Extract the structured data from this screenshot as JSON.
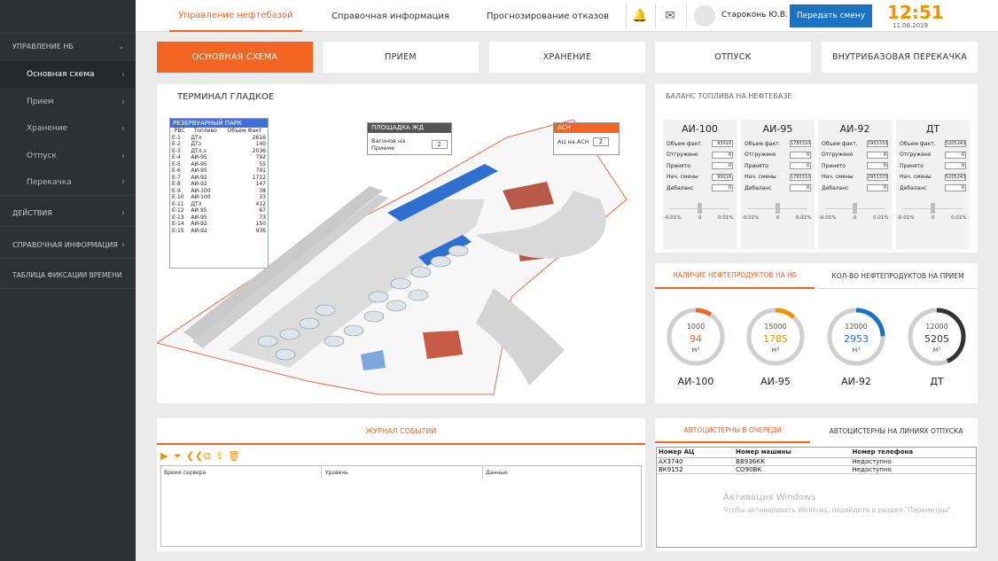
{
  "sidebar": {
    "items": [
      {
        "label": "УПРАВЛЕНИЕ НБ",
        "chev": "⌄"
      },
      {
        "label": "Основная схема",
        "chev": "›"
      },
      {
        "label": "Прием",
        "chev": "›"
      },
      {
        "label": "Хранение",
        "chev": "›"
      },
      {
        "label": "Отпуск",
        "chev": "›"
      },
      {
        "label": "Перекачка",
        "chev": "›"
      },
      {
        "label": "ДЕЙСТВИЯ",
        "chev": "›"
      },
      {
        "label": "СПРАВОЧНАЯ ИНФОРМАЦИЯ",
        "chev": "›"
      },
      {
        "label": "ТАБЛИЦА ФИКСАЦИИ ВРЕМЕНИ",
        "chev": ""
      }
    ]
  },
  "header": {
    "tabs": [
      "Управление нефтебазой",
      "Справочная информация",
      "Прогнозирование отказов"
    ],
    "bell_icon": "🔔",
    "mail_icon": "✉",
    "username": "Староконь Ю.В.",
    "shift_button": "Передать смену",
    "time": "12:51",
    "date": "11.06.2019"
  },
  "subtabs": [
    "ОСНОВНАЯ СХЕМА",
    "ПРИЕМ",
    "ХРАНЕНИЕ",
    "ОТПУСК",
    "ВНУТРИБАЗОВАЯ ПЕРЕКАЧКА"
  ],
  "terminal": {
    "title": "ТЕРМИНАЛ ГЛАДКОЕ",
    "reservoir_park": {
      "title": "РЕЗЕРВУАРНЫЙ ПАРК",
      "columns": [
        "РВС",
        "Топливо",
        "Объем Факт"
      ],
      "rows": [
        [
          "Е-1",
          "ДТл",
          "2616"
        ],
        [
          "Е-2",
          "ДТз",
          "140"
        ],
        [
          "Е-3",
          "ДТл,з",
          "2036"
        ],
        [
          "Е-4",
          "АИ-95",
          "792"
        ],
        [
          "Е-5",
          "АИ-95",
          "55"
        ],
        [
          "Е-6",
          "АИ-95",
          "791"
        ],
        [
          "Е-7",
          "АИ-92",
          "1722"
        ],
        [
          "Е-8",
          "АИ-92",
          "147"
        ],
        [
          "Е-9",
          "АИ-100",
          "38"
        ],
        [
          "Е-10",
          "АИ-100",
          "33"
        ],
        [
          "Е-11",
          "ДТл",
          "412"
        ],
        [
          "Е-12",
          "АИ 95",
          "67"
        ],
        [
          "Е-13",
          "АИ-95",
          "73"
        ],
        [
          "Е-14",
          "АИ-92",
          "150"
        ],
        [
          "Е-15",
          "АИ-92",
          "936"
        ]
      ]
    },
    "railway": {
      "title": "ПЛОЩАДКА ЖД",
      "label": "Вагонов на Приеме",
      "value": "2"
    },
    "asn": {
      "title": "АСН",
      "label": "АЦ на АСН",
      "value": "2"
    }
  },
  "balance": {
    "title": "БАЛАНС ТОПЛИВА НА НЕФТЕБАЗЕ",
    "columns": [
      {
        "name": "АИ-100",
        "rows": [
          [
            "Объем факт.",
            "93018"
          ],
          [
            "Отгружено",
            "0"
          ],
          [
            "Принято",
            "0"
          ],
          [
            "Нач. смены",
            "93018"
          ],
          [
            "Дебаланс",
            "0"
          ]
        ]
      },
      {
        "name": "АИ-95",
        "rows": [
          [
            "Объем факт.",
            "1783310"
          ],
          [
            "Отгружено",
            "0"
          ],
          [
            "Принято",
            "0"
          ],
          [
            "Нач. смены",
            "1783310"
          ],
          [
            "Дебаланс",
            "0"
          ]
        ]
      },
      {
        "name": "АИ-92",
        "rows": [
          [
            "Объем факт.",
            "2953333"
          ],
          [
            "Отгружено",
            "0"
          ],
          [
            "Принято",
            "0"
          ],
          [
            "Нач. смены",
            "2953333"
          ],
          [
            "Дебаланс",
            "0"
          ]
        ]
      },
      {
        "name": "ДТ",
        "rows": [
          [
            "Объем факт.",
            "5205243"
          ],
          [
            "Отгружено",
            "0"
          ],
          [
            "Принято",
            "0"
          ],
          [
            "Нач. смены",
            "5205243"
          ],
          [
            "Дебаланс",
            "0"
          ]
        ]
      }
    ],
    "scale": [
      "-0.01%",
      "0",
      "0.01%"
    ]
  },
  "availability": {
    "tabs": [
      "НАЛИЧИЕ НЕФТЕПРОДУКТОВ НА НБ",
      "КОЛ-ВО НЕФТЕПРОДУКТОВ НА ПРИЕМ"
    ],
    "unit": "м³",
    "gauges": [
      {
        "name": "АИ-100",
        "capacity": "1000",
        "value": "94",
        "fraction": 0.094,
        "color": "#f26522"
      },
      {
        "name": "АИ-95",
        "capacity": "15000",
        "value": "1785",
        "fraction": 0.119,
        "color": "#f39200"
      },
      {
        "name": "АИ-92",
        "capacity": "12000",
        "value": "2953",
        "fraction": 0.246,
        "color": "#1b73c4"
      },
      {
        "name": "ДТ",
        "capacity": "12000",
        "value": "5205",
        "fraction": 0.434,
        "color": "#333333"
      }
    ]
  },
  "journal": {
    "title": "ЖУРНАЛ СОБЫТИЙ",
    "columns": [
      "Время сервера",
      "Уровень",
      "Данные"
    ]
  },
  "queue": {
    "tabs": [
      "АВТОЦИСТЕРНЫ В ОЧЕРЕДИ",
      "АВТОЦИСТЕРНЫ НА ЛИНИЯХ ОТПУСКА"
    ],
    "columns": [
      "Номер АЦ",
      "Номер машины",
      "Номер телефона"
    ],
    "rows": [
      [
        "АХ3740",
        "ВВ936КК",
        "Недоступно"
      ],
      [
        "ВК9152",
        "СО90ВК",
        "Недоступно"
      ]
    ]
  },
  "watermark": {
    "line1": "Активация Windows",
    "line2": "Чтобы активировать Windows, перейдите в раздел \"Параметры\"."
  }
}
